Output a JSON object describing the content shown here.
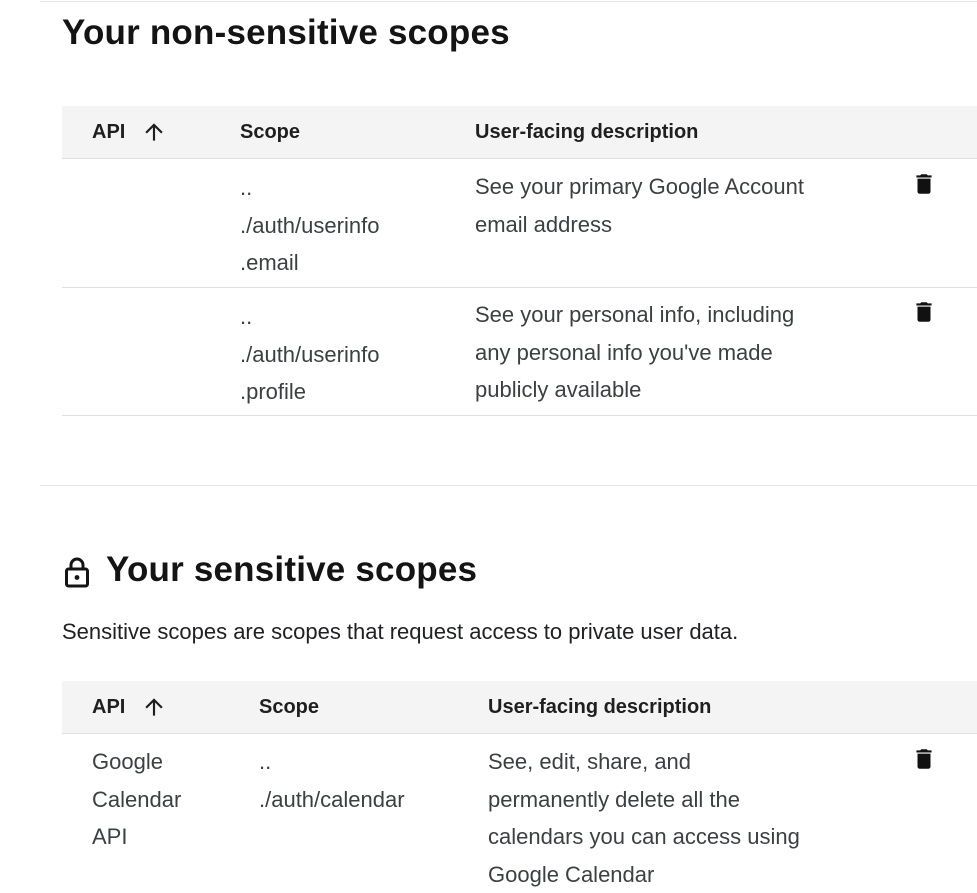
{
  "non_sensitive": {
    "title": "Your non-sensitive scopes",
    "headers": {
      "api": "API",
      "scope": "Scope",
      "description": "User-facing description"
    },
    "rows": [
      {
        "api": "",
        "scope_lines": [
          "..",
          "./auth/userinfo",
          ".email"
        ],
        "desc_lines": [
          "See your primary Google Account",
          "email address"
        ]
      },
      {
        "api": "",
        "scope_lines": [
          "..",
          "./auth/userinfo",
          ".profile"
        ],
        "desc_lines": [
          "See your personal info, including",
          "any personal info you've made",
          "publicly available"
        ]
      }
    ]
  },
  "sensitive": {
    "title": "Your sensitive scopes",
    "description": "Sensitive scopes are scopes that request access to private user data.",
    "headers": {
      "api": "API",
      "scope": "Scope",
      "description": "User-facing description"
    },
    "rows": [
      {
        "api_lines": [
          "Google",
          "Calendar",
          "API"
        ],
        "scope_lines": [
          "..",
          "./auth/calendar"
        ],
        "desc_lines": [
          "See, edit, share, and",
          "permanently delete all the",
          "calendars you can access using",
          "Google Calendar"
        ]
      }
    ]
  },
  "icons": {
    "sort": "arrow-upward-icon",
    "delete": "trash-icon",
    "lock": "lock-icon"
  }
}
